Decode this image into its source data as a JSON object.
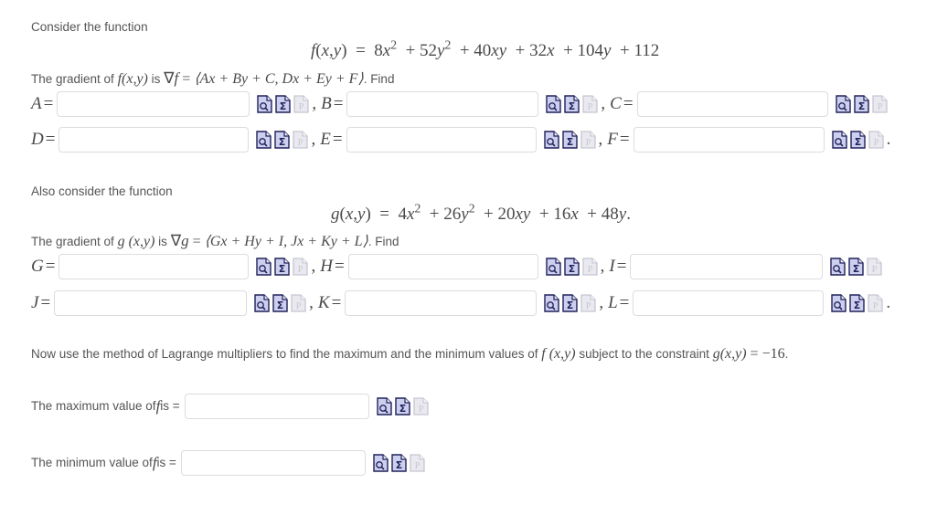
{
  "problem": {
    "intro_1": "Consider the function",
    "equation_f": {
      "lhs": "f(x,y)",
      "rhs_parts": [
        {
          "coef": "8",
          "var": "x",
          "exp": "2"
        },
        {
          "coef": "52",
          "var": "y",
          "exp": "2"
        },
        {
          "coef": "40",
          "var": "xy",
          "exp": ""
        },
        {
          "coef": "32",
          "var": "x",
          "exp": ""
        },
        {
          "coef": "104",
          "var": "y",
          "exp": ""
        },
        {
          "coef": "112",
          "var": "",
          "exp": ""
        }
      ],
      "plain": "f(x,y) = 8x^2 + 52y^2 + 40xy + 32x + 104y + 112"
    },
    "gradient_f_text_before": "The gradient of ",
    "gradient_f_fn": "f(x,y)",
    "gradient_f_is": " is ",
    "gradient_f_grad": "∇f",
    "gradient_f_eq": " = ",
    "gradient_f_components": "⟨Ax + By + C,  Dx + Ey + F⟩",
    "gradient_f_find": ". Find",
    "intro_2": "Also consider the function",
    "equation_g": {
      "lhs": "g(x,y)",
      "plain": "g(x,y) = 4x^2 + 26y^2 + 20xy + 16x + 48y."
    },
    "gradient_g_text_before": "The gradient of ",
    "gradient_g_fn": "g (x,y)",
    "gradient_g_is": " is ",
    "gradient_g_grad": "∇g",
    "gradient_g_eq": " = ",
    "gradient_g_components": "⟨Gx + Hy + I,  Jx + Ky + L⟩",
    "gradient_g_find": ". Find",
    "lagrange_part1": "Now use the method of Lagrange multipliers to find the maximum and the minimum values of ",
    "lagrange_fn": "f (x,y)",
    "lagrange_part2": " subject to the constraint ",
    "lagrange_constraint": "g(x,y) = −16",
    "lagrange_period": ".",
    "max_label_pre": "The maximum value of ",
    "max_label_fn": "f",
    "max_label_post": " is =",
    "min_label_pre": "The minimum value of ",
    "min_label_fn": "f",
    "min_label_post": " is ="
  },
  "answer_rows": [
    {
      "var": "A",
      "eq": "=",
      "value": "",
      "placeholder": "",
      "trailing": ","
    },
    {
      "var": "B",
      "eq": "=",
      "value": "",
      "placeholder": "",
      "trailing": ","
    },
    {
      "var": "C",
      "eq": "=",
      "value": "",
      "placeholder": "",
      "trailing": ""
    },
    {
      "var": "D",
      "eq": "=",
      "value": "",
      "placeholder": "",
      "trailing": ","
    },
    {
      "var": "E",
      "eq": "=",
      "value": "",
      "placeholder": "",
      "trailing": ","
    },
    {
      "var": "F",
      "eq": "=",
      "value": "",
      "placeholder": "",
      "trailing": "."
    },
    {
      "var": "G",
      "eq": "=",
      "value": "",
      "placeholder": "",
      "trailing": ","
    },
    {
      "var": "H",
      "eq": "=",
      "value": "",
      "placeholder": "",
      "trailing": ","
    },
    {
      "var": "I",
      "eq": "=",
      "value": "",
      "placeholder": "",
      "trailing": ""
    },
    {
      "var": "J",
      "eq": "=",
      "value": "",
      "placeholder": "",
      "trailing": ","
    },
    {
      "var": "K",
      "eq": "=",
      "value": "",
      "placeholder": "",
      "trailing": ","
    },
    {
      "var": "L",
      "eq": "=",
      "value": "",
      "placeholder": "",
      "trailing": "."
    }
  ],
  "final_answers": [
    {
      "id": "maximum",
      "value": "",
      "placeholder": ""
    },
    {
      "id": "minimum",
      "value": "",
      "placeholder": ""
    }
  ],
  "icons": {
    "preview": "preview-magnifier-icon",
    "symbolic": "sigma-symbolic-icon",
    "help": "page-help-icon-disabled",
    "preview_title": "Preview",
    "symbolic_title": "Symbolic formatting help",
    "help_title": "Help"
  },
  "colors": {
    "text": "#555555",
    "math_text": "#4a4a4a",
    "input_border": "#dcdcdc",
    "icon_fill": "#ccd0ee",
    "icon_stroke": "#20205a",
    "icon_disabled_fill": "#e3e3e8",
    "icon_disabled_stroke": "#c2c2cc",
    "background": "#ffffff"
  }
}
